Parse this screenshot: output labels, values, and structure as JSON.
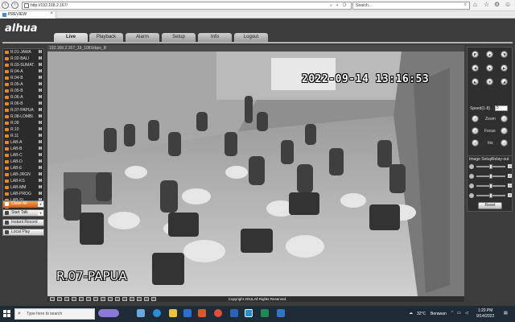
{
  "browser": {
    "address": "http://192.168.2.167/",
    "search_placeholder": "Search...",
    "tab_title": "PREVIEW"
  },
  "app": {
    "logo": "alhua",
    "menu": [
      "Live",
      "Playback",
      "Alarm",
      "Setup",
      "Info",
      "Logout"
    ],
    "active_menu": "Live"
  },
  "channels": [
    {
      "label": "R.01-JAWA",
      "flag": "M"
    },
    {
      "label": "R.02-BALI",
      "flag": "M"
    },
    {
      "label": "R.03-SUMAT.",
      "flag": "M"
    },
    {
      "label": "R.04-A",
      "flag": "M"
    },
    {
      "label": "R.04-B",
      "flag": "M"
    },
    {
      "label": "R.05-A",
      "flag": "M"
    },
    {
      "label": "R.05-B",
      "flag": "M"
    },
    {
      "label": "R.06-A",
      "flag": "M"
    },
    {
      "label": "R.06-B",
      "flag": "M"
    },
    {
      "label": "R.07-PAPUA",
      "flag": "M"
    },
    {
      "label": "R.08-LOMBI.",
      "flag": "M"
    },
    {
      "label": "R.09",
      "flag": "M"
    },
    {
      "label": "R.10",
      "flag": "M"
    },
    {
      "label": "R.11",
      "flag": "M"
    },
    {
      "label": "LAB-A",
      "flag": "M"
    },
    {
      "label": "LAB-B",
      "flag": "M"
    },
    {
      "label": "LAB-C",
      "flag": "M"
    },
    {
      "label": "LAB-D",
      "flag": "M"
    },
    {
      "label": "LAB-E",
      "flag": "M"
    },
    {
      "label": "LAB-JRGN",
      "flag": "M"
    },
    {
      "label": "LAB-KS",
      "flag": "M"
    },
    {
      "label": "LAB-MM",
      "flag": "M"
    },
    {
      "label": "LAB-PROG",
      "flag": "M"
    },
    {
      "label": "LAB-SI",
      "flag": "M"
    },
    {
      "label": "AULA-1",
      "flag": "M"
    }
  ],
  "left_buttons": {
    "close_all": "Close All",
    "start_talk": "Start Talk",
    "instant_record": "Instant Record",
    "local_play": "Local Play"
  },
  "video": {
    "header": "192.168.2.167_19_1081kbps_R",
    "timestamp": "2022-09-14 13:16:53",
    "channel_name": "R.07-PAPUA"
  },
  "ptz": {
    "speed_label": "Speed(1-8)",
    "speed_value": "5",
    "zoom": "Zoom",
    "focus": "Focus",
    "iris": "Iris"
  },
  "image_setup": {
    "title": "Image Setup",
    "relay": "Relay-out",
    "reset": "Reset",
    "levels": [
      0.5,
      0.5,
      0.5,
      0.5
    ]
  },
  "copyright": "Copyright 2015,All Rights Reserved.",
  "taskbar": {
    "search_placeholder": "Type here to search",
    "temp": "32°C",
    "weather": "Berawan",
    "time": "1:20 PM",
    "date": "9/14/2022"
  }
}
